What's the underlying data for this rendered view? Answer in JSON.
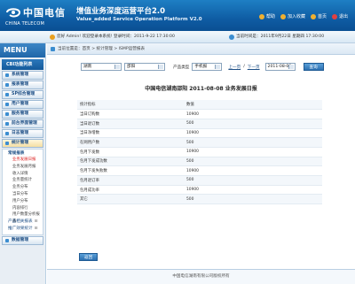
{
  "header": {
    "logo_cn": "中国电信",
    "logo_en": "CHINA TELECOM",
    "title": "增值业务深度运营平台2.0",
    "subtitle": "Value_added Service Operation Platform V2.0",
    "links": [
      {
        "label": "帮助",
        "color": "#f0b030"
      },
      {
        "label": "加入收藏",
        "color": "#f0b030"
      },
      {
        "label": "首页",
        "color": "#f0b030"
      },
      {
        "label": "退出",
        "color": "#e04040"
      }
    ]
  },
  "welcome": {
    "text": "您好 Admin! 欢迎登录本系统! 登录时间：2011-9-22  17:30:00",
    "time": "当前时间是：2011年9月22日 星期四  17:30:00"
  },
  "sidebar": {
    "menu_title": "MENU",
    "category": "CBI功能列表",
    "items": [
      {
        "label": "系统管理"
      },
      {
        "label": "报表管理"
      },
      {
        "label": "SP综合管理"
      },
      {
        "label": "用户管理"
      },
      {
        "label": "服务管理"
      },
      {
        "label": "前台界面管理"
      },
      {
        "label": "日志管理"
      },
      {
        "label": "统计管理"
      }
    ],
    "submenu": {
      "head": "常规报表",
      "items": [
        {
          "label": "业务发展日报"
        },
        {
          "label": "业务发展月报"
        },
        {
          "label": "收入详情"
        },
        {
          "label": "业务量统计"
        },
        {
          "label": "业务分布"
        },
        {
          "label": "当日分布"
        },
        {
          "label": "用户分布"
        },
        {
          "label": "内容排行"
        },
        {
          "label": "用户数量分析报表"
        }
      ],
      "head2": "产品相关报表",
      "head3": "推广效果统计"
    },
    "last_item": {
      "label": "数据管理"
    }
  },
  "main": {
    "breadcrumb": "当前位置是：首页 > 统计管理 > ISMP运营报表",
    "filters": {
      "province": "湖南",
      "city": "邵阳",
      "product_type_label": "产品类型",
      "product_type": "手机报",
      "prev_link": "上一页",
      "next_link": "下一页",
      "date": "2011-08-08",
      "query_button": "查询"
    },
    "report_title": "中国电信湖南邵阳 2011-08-08 业务发展日报",
    "table": {
      "header": [
        "统计指标",
        "数值"
      ],
      "rows": [
        [
          "当日订购数",
          "10900"
        ],
        [
          "当日退订数",
          "500"
        ],
        [
          "当日净增数",
          "10900"
        ],
        [
          "在网用户数",
          "500"
        ],
        [
          "包月下发数",
          "10900"
        ],
        [
          "包月下发成功数",
          "500"
        ],
        [
          "包月下发失败数",
          "10900"
        ],
        [
          "包月退订率",
          "500"
        ],
        [
          "包月成功率",
          "10900"
        ],
        [
          "其它",
          "500"
        ]
      ]
    },
    "back_button": "返回"
  },
  "footer": {
    "text": "中国电信湖南有限公司版权所有"
  }
}
